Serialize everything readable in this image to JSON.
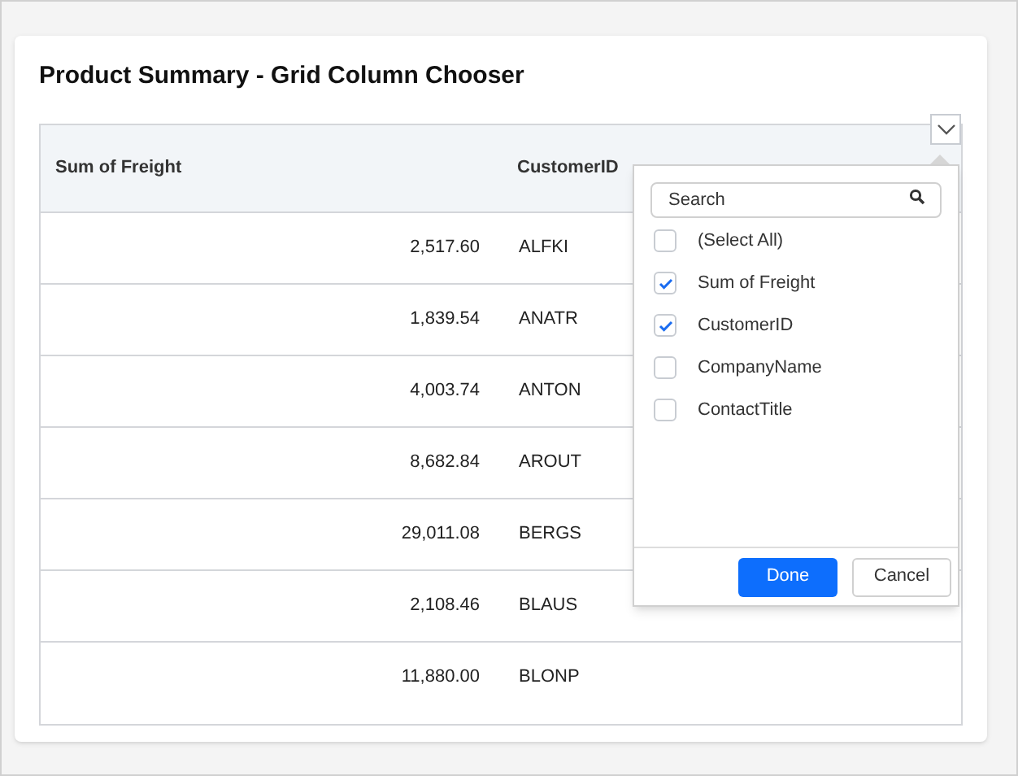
{
  "title": "Product Summary - Grid Column Chooser",
  "table": {
    "columns": [
      "Sum of Freight",
      "CustomerID"
    ],
    "rows": [
      [
        "2,517.60",
        "ALFKI"
      ],
      [
        "1,839.54",
        "ANATR"
      ],
      [
        "4,003.74",
        "ANTON"
      ],
      [
        "8,682.84",
        "AROUT"
      ],
      [
        "29,011.08",
        "BERGS"
      ],
      [
        "2,108.46",
        "BLAUS"
      ],
      [
        "11,880.00",
        "BLONP"
      ]
    ]
  },
  "column_chooser": {
    "expanded": true,
    "search": {
      "placeholder": "Search"
    },
    "items": [
      {
        "label": "(Select All)",
        "checked": false
      },
      {
        "label": "Sum of Freight",
        "checked": true
      },
      {
        "label": "CustomerID",
        "checked": true
      },
      {
        "label": "CompanyName",
        "checked": false
      },
      {
        "label": "ContactTitle",
        "checked": false
      }
    ],
    "buttons": [
      {
        "label": "Done",
        "kind": "primary"
      },
      {
        "label": "Cancel",
        "kind": "secondary"
      }
    ]
  }
}
